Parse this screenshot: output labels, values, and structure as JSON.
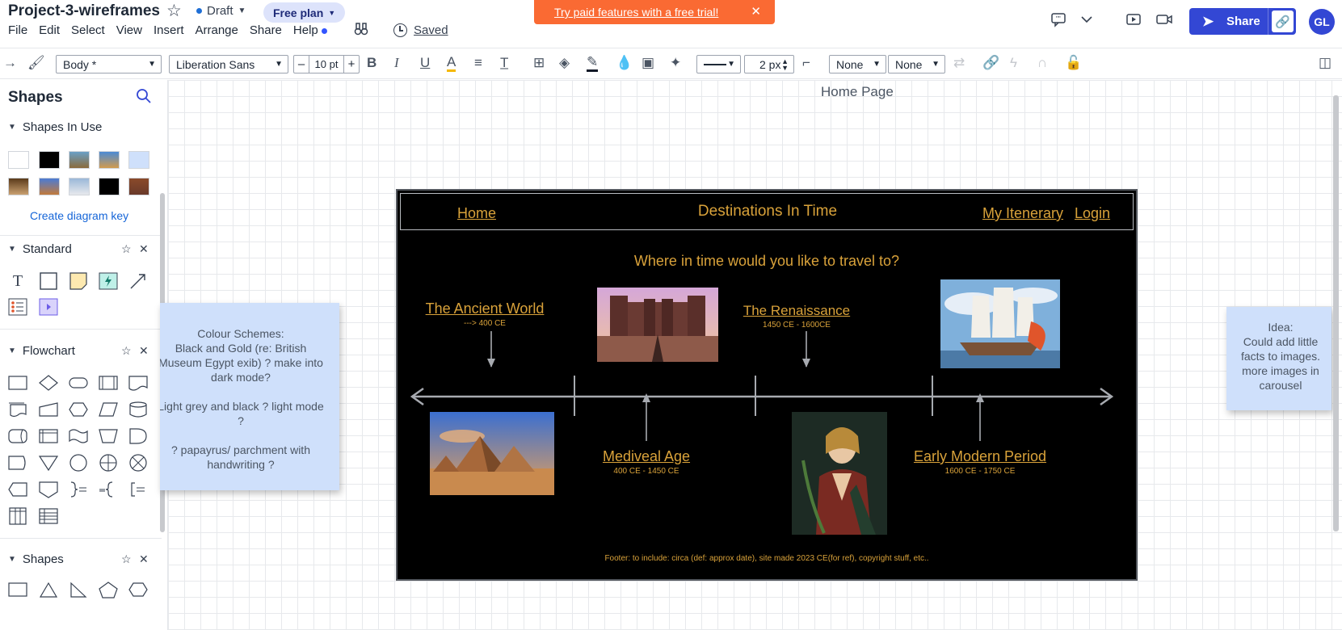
{
  "header": {
    "doc_title": "Project-3-wireframes",
    "status": "Draft",
    "plan": "Free plan",
    "menu": [
      "File",
      "Edit",
      "Select",
      "View",
      "Insert",
      "Arrange",
      "Share",
      "Help"
    ],
    "saved_label": "Saved",
    "trial_banner": "Try paid features with a free trial!",
    "share_label": "Share",
    "avatar_initials": "GL",
    "accent_color": "#3347d4",
    "banner_color": "#fa6a33"
  },
  "toolbar": {
    "style_select": "Body *",
    "font_select": "Liberation Sans",
    "font_size": "10 pt",
    "line_width": "2 px",
    "start_arrow": "None",
    "end_arrow": "None"
  },
  "left_panel": {
    "title": "Shapes",
    "sections": {
      "in_use": "Shapes In Use",
      "standard": "Standard",
      "flowchart": "Flowchart",
      "shapes": "Shapes"
    },
    "diagram_key_link": "Create diagram key"
  },
  "canvas": {
    "page_label": "Home Page",
    "note_colour_schemes": [
      "Colour Schemes:",
      "Black and Gold (re: British",
      "Museum Egypt exib) ? make into",
      "dark mode?",
      "",
      "Light grey and black ? light mode",
      "?",
      "",
      "? papayrus/ parchment with",
      "handwriting ?"
    ],
    "note_idea": [
      "Idea:",
      "Could add little",
      "facts to images.",
      "more images in",
      "carousel"
    ],
    "wireframe": {
      "nav_home": "Home",
      "site_title": "Destinations In Time",
      "nav_itinerary": "My Itenerary",
      "nav_login": "Login",
      "tagline": "Where in time would you like to travel to?",
      "eras": [
        {
          "name": "The Ancient World",
          "dates": "---> 400 CE"
        },
        {
          "name": "Mediveal Age",
          "dates": "400 CE - 1450 CE"
        },
        {
          "name": "The Renaissance",
          "dates": "1450 CE - 1600CE"
        },
        {
          "name": "Early Modern Period",
          "dates": "1600 CE - 1750 CE"
        }
      ],
      "footer": "Footer: to include: circa (def: approx date), site made 2023 CE(for ref), copyright stuff, etc..",
      "brand_gold": "#d9a23a"
    }
  }
}
